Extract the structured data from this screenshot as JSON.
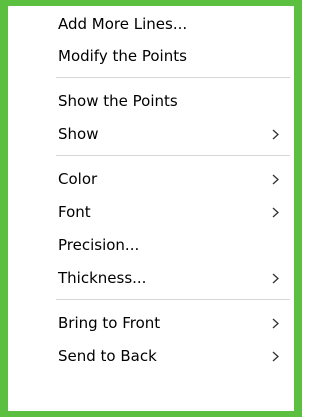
{
  "menu": {
    "items": [
      {
        "label": "Add More Lines...",
        "submenu": false
      },
      {
        "label": "Modify the Points",
        "submenu": false
      },
      {
        "label": "Show the Points",
        "submenu": false
      },
      {
        "label": "Show",
        "submenu": true
      },
      {
        "label": "Color",
        "submenu": true
      },
      {
        "label": "Font",
        "submenu": true
      },
      {
        "label": "Precision...",
        "submenu": false
      },
      {
        "label": "Thickness...",
        "submenu": true
      },
      {
        "label": "Bring to Front",
        "submenu": true
      },
      {
        "label": "Send to Back",
        "submenu": true
      }
    ]
  },
  "colors": {
    "frame": "#5bbf3f",
    "separator": "#d7d7d7"
  },
  "icons": {
    "submenu": "chevron-right-icon"
  }
}
